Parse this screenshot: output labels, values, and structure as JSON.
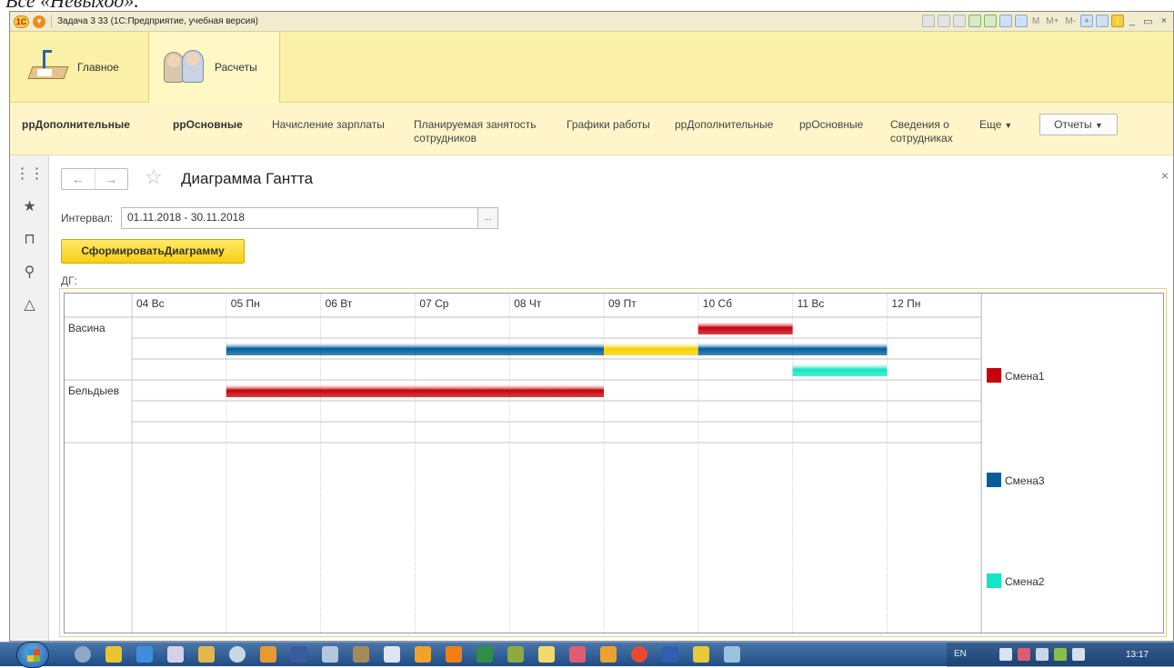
{
  "top_crop_text": "Все «Невыход».",
  "window": {
    "title": "Задача 3 33  (1С:Предприятие, учебная версия)",
    "toolbar_text": [
      "M",
      "M+",
      "M-"
    ]
  },
  "sections": [
    {
      "label": "Главное",
      "icon": "desk-lamp-icon"
    },
    {
      "label": "Расчеты",
      "icon": "people-icon"
    }
  ],
  "commands": [
    {
      "label": "ррДополнительные",
      "bold": true
    },
    {
      "label": "ррОсновные",
      "bold": true
    },
    {
      "label": "Начисление зарплаты"
    },
    {
      "label": "Планируемая занятость сотрудников"
    },
    {
      "label": "Графики работы"
    },
    {
      "label": "ррДополнительные"
    },
    {
      "label": "ррОсновные"
    },
    {
      "label": "Сведения о сотрудниках"
    },
    {
      "label": "Еще"
    }
  ],
  "reports_button": "Отчеты",
  "page": {
    "title": "Диаграмма Гантта",
    "interval_label": "Интервал:",
    "interval_value": "01.11.2018 - 30.11.2018",
    "interval_button": "...",
    "generate_button": "СформироватьДиаграмму",
    "chart_label": "ДГ:"
  },
  "chart_data": {
    "type": "gantt",
    "days": [
      "04 Вс",
      "05 Пн",
      "06 Вт",
      "07 Ср",
      "08 Чт",
      "09 Пт",
      "10 Сб",
      "11 Вс",
      "12 Пн"
    ],
    "employees": [
      {
        "name": "Васина",
        "rows": [
          [
            {
              "series": "Смена1",
              "start": "10 Сб",
              "end": "11 Вс"
            }
          ],
          [
            {
              "series": "Смена3",
              "start": "05 Пн",
              "end": "09 Пт"
            },
            {
              "series": "Yellow",
              "start": "09 Пт",
              "end": "10 Сб"
            },
            {
              "series": "Смена3",
              "start": "10 Сб",
              "end": "12 Пн"
            }
          ],
          [
            {
              "series": "Смена2",
              "start": "11 Вс",
              "end": "12 Пн"
            }
          ]
        ]
      },
      {
        "name": "Бельдыев",
        "rows": [
          [
            {
              "series": "Смена1",
              "start": "05 Пн",
              "end": "09 Пт"
            }
          ],
          [],
          []
        ]
      }
    ],
    "legend": [
      {
        "name": "Смена1",
        "color": "#c8000a"
      },
      {
        "name": "Смена3",
        "color": "#005e9c"
      },
      {
        "name": "Смена2",
        "color": "#13e6c4"
      }
    ],
    "colors": {
      "Смена1": "#c8000a",
      "Смена3": "#005e9c",
      "Смена2": "#13e6c4",
      "Yellow": "#f7d000"
    }
  },
  "taskbar": {
    "language": "EN",
    "clock": "13:17"
  }
}
